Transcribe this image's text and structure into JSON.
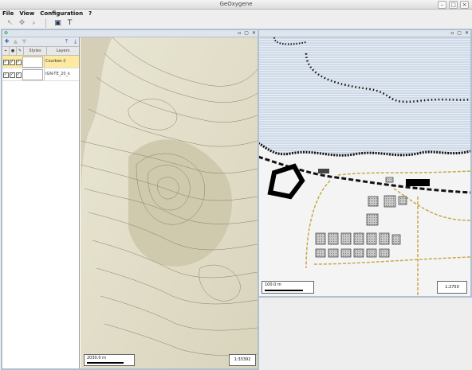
{
  "app": {
    "title": "GeOxygene"
  },
  "window_buttons": [
    "–",
    "□",
    "×"
  ],
  "menu": [
    "File",
    "View",
    "Configuration",
    "?"
  ],
  "toolbar": {
    "tools": [
      {
        "icon": "select-arrow-icon",
        "glyph": "↖",
        "active": false
      },
      {
        "icon": "move-cross-icon",
        "glyph": "✥",
        "active": false
      },
      {
        "icon": "zoom-icon",
        "glyph": "⌕",
        "active": false
      },
      {
        "icon": "map-window-icon",
        "glyph": "▣",
        "active": true
      },
      {
        "icon": "text-tool-icon",
        "glyph": "T",
        "active": true
      }
    ]
  },
  "frame_buttons": [
    "▫",
    "▢",
    "✕"
  ],
  "layer_panel": {
    "tools": [
      {
        "icon": "add-layer-icon",
        "glyph": "✚",
        "enabled": true
      },
      {
        "icon": "move-layer-up-icon",
        "glyph": "▲",
        "enabled": false
      },
      {
        "icon": "move-layer-down-icon",
        "glyph": "▼",
        "enabled": false
      },
      {
        "icon": "layer-top-icon",
        "glyph": "⤒",
        "enabled": true
      },
      {
        "icon": "layer-bottom-icon",
        "glyph": "⤓",
        "enabled": true
      }
    ],
    "headers": {
      "select_glyph": "⌖",
      "visible_glyph": "●",
      "edit_glyph": "✎",
      "styles": "Styles",
      "layers": "Layers"
    },
    "rows": [
      {
        "name": "Courbes (l",
        "checks": [
          true,
          true,
          true
        ],
        "selected": true
      },
      {
        "name": "IGN-TE_20_k",
        "checks": [
          true,
          true,
          true
        ],
        "selected": false
      }
    ]
  },
  "left_map": {
    "scale_text": "2030.0 m",
    "ratio": "1:33392"
  },
  "right_map": {
    "scale_text": "100.0 m",
    "ratio": "1:2750"
  }
}
